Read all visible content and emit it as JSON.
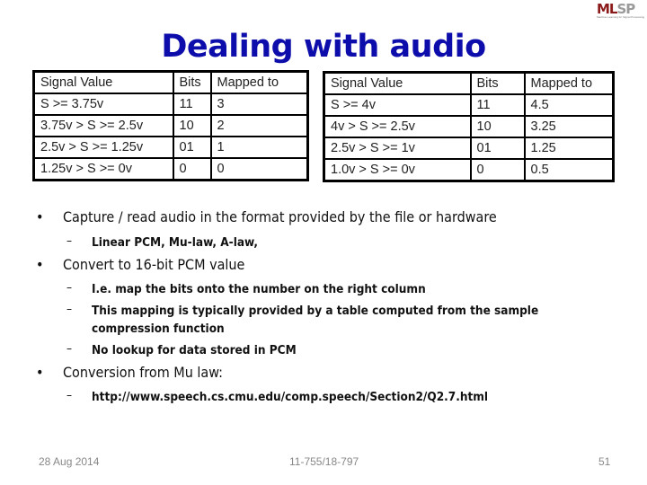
{
  "logo": {
    "text_primary": "ML",
    "text_secondary": "SP",
    "tagline": "Machine Learning for Signal Processing"
  },
  "title": "Dealing with audio",
  "tables": [
    {
      "headers": [
        "Signal Value",
        "Bits",
        "Mapped to"
      ],
      "rows": [
        [
          "S >= 3.75v",
          "11",
          "3"
        ],
        [
          "3.75v > S >= 2.5v",
          "10",
          "2"
        ],
        [
          "2.5v > S >= 1.25v",
          "01",
          "1"
        ],
        [
          "1.25v > S >= 0v",
          "0",
          "0"
        ]
      ]
    },
    {
      "headers": [
        "Signal Value",
        "Bits",
        "Mapped to"
      ],
      "rows": [
        [
          "S >= 4v",
          "11",
          "4.5"
        ],
        [
          "4v > S >= 2.5v",
          "10",
          "3.25"
        ],
        [
          "2.5v > S >= 1v",
          "01",
          "1.25"
        ],
        [
          "1.0v > S >= 0v",
          "0",
          "0.5"
        ]
      ]
    }
  ],
  "bullets": [
    {
      "text": "Capture / read audio in the format provided by the file or hardware",
      "sub": [
        "Linear PCM, Mu-law, A-law,"
      ]
    },
    {
      "text": "Convert to 16-bit PCM value",
      "sub": [
        "I.e. map the bits onto the number on the right column",
        "This mapping is typically provided by a table computed from the sample compression function",
        "No lookup for data stored in PCM"
      ]
    },
    {
      "text": "Conversion from  Mu law:",
      "sub": [
        "http://www.speech.cs.cmu.edu/comp.speech/Section2/Q2.7.html"
      ]
    }
  ],
  "bullet_glyph": "•",
  "dash_glyph": "–",
  "footer": {
    "date": "28 Aug 2014",
    "course": "11-755/18-797",
    "page": "51"
  }
}
